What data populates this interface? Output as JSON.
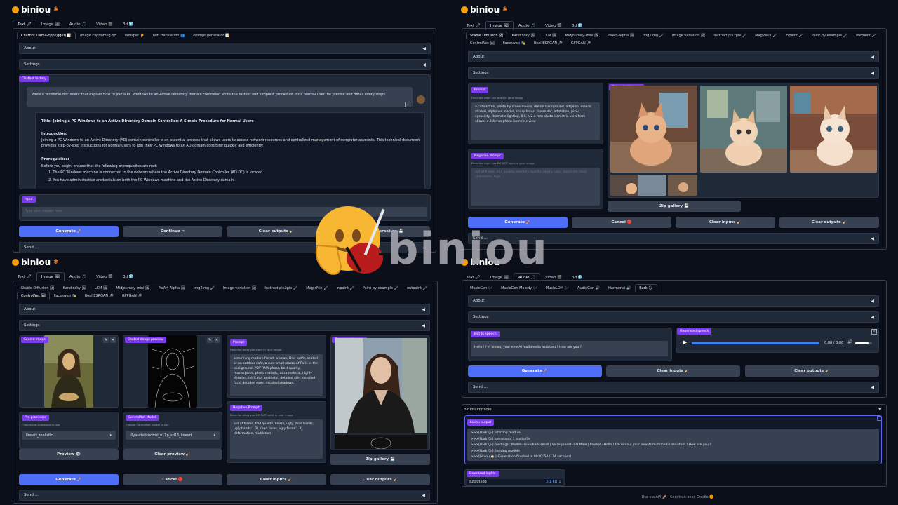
{
  "brand": {
    "name": "biniou",
    "big_name": "biniou"
  },
  "top_tabs": {
    "text": "Text 🖊",
    "image": "Image 🖼",
    "audio": "Audio 🎵",
    "video": "Video 🎬",
    "d3": "3d 🧊"
  },
  "q1": {
    "subtabs": [
      "Chatbot Llama-cpp (gguf) 📝",
      "Image captioning 👁",
      "Whisper 👂",
      "nllb translation 👥",
      "Prompt generator 📝"
    ],
    "about": "About",
    "settings": "Settings",
    "history_tag": "Chatbot history",
    "user_msg": "Write a technical document that explain how to join a PC Windows to an Active Directory domain controller. Write the fastest and simplest procedure for a normal user. Be precise and detail every steps.",
    "bot_title": "Title: Joining a PC Windows to an Active Directory Domain Controller: A Simple Procedure for Normal Users",
    "bot_intro_h": "Introduction:",
    "bot_intro": "Joining a PC Windows to an Active Directory (AD) domain controller is an essential process that allows users to access network resources and centralized management of computer accounts. This technical document provides step-by-step instructions for normal users to join their PC Windows to an AD domain controller quickly and efficiently.",
    "bot_pre_h": "Prerequisites:",
    "bot_pre": "Before you begin, ensure that the following prerequisites are met:",
    "bot_li1": "1. The PC Windows machine is connected to the network where the Active Directory Domain Controller (AD DC) is located.",
    "bot_li2": "2. You have administrative credentials on both the PC Windows machine and the Active Directory domain.",
    "input_tag": "Input",
    "input_ph": "Type your request here",
    "btn_generate": "Generate 🚀",
    "btn_continue": "Continue ➡",
    "btn_clear": "Clear outputs 🧹",
    "btn_save": "Save conversation 💾",
    "send": "Send ..."
  },
  "q2": {
    "subtabs_row1": [
      "Stable Diffusion 🖼",
      "Kandinsky 🖼",
      "LCM 🖼",
      "Midjourney-mini 🖼",
      "PixArt-Alpha 🖼",
      "img2img 🖌",
      "Image variation 🖼",
      "Instruct pix2pix 🖌",
      "MagicMix 🖌",
      "Inpaint 🖌",
      "Paint by example 🖌",
      "outpaint 🖌"
    ],
    "subtabs_row2": [
      "ControlNet 🖼",
      "Faceswap 🎭",
      "Real ESRGAN 🔎",
      "GFPGAN 🔎"
    ],
    "about": "About",
    "settings": "Settings",
    "prompt_tag": "Prompt",
    "prompt_hint": "Describe what you want in your image",
    "prompt": "a cute kitten,  photo by steve meisin, dream background, artgerm, malicic shinkai, alphonse macha, sharp focus, cinematic, artstation, pixiv, cgsociety, dramatic lighting, 8 k, a 2.4 mm photo isometric view from above. a 2.4 mm photo isometric view",
    "neg_tag": "Negative Prompt",
    "neg_hint": "Describe what you DO NOT want in your image",
    "neg": "out of frame, bad quality, medium quality, blurry, ugly, duplicate, text, characters, logo",
    "gen_tag": "Generated images",
    "zip": "Zip gallery 💾",
    "btn_generate": "Generate 🚀",
    "btn_cancel": "Cancel 🛑",
    "btn_clear_in": "Clear inputs 🧹",
    "btn_clear_out": "Clear outputs 🧹",
    "send": "Send ..."
  },
  "q3": {
    "subtabs_row1": [
      "Stable Diffusion 🖼",
      "Kandinsky 🖼",
      "LCM 🖼",
      "Midjourney-mini 🖼",
      "PixArt-Alpha 🖼",
      "img2img 🖌",
      "Image variation 🖼",
      "Instruct pix2pix 🖌",
      "MagicMix 🖌",
      "Inpaint 🖌",
      "Paint by example 🖌",
      "outpaint 🖌"
    ],
    "subtabs_row2": [
      "ControlNet 🖼",
      "Faceswap 🎭",
      "Real ESRGAN 🔎",
      "GFPGAN 🔎"
    ],
    "about": "About",
    "settings": "Settings",
    "source_tag": "Source image",
    "control_tag": "Control image preview",
    "prompt_tag": "Prompt",
    "prompt_hint": "Describe what you want in your image",
    "prompt": "a stunning modern french woman, Dior outfit, seated at an outdoor cafe, a cute small plazza of Paris in the background, POV RAW photo, best quality, masterpiece, photo realistic, ultra realistic, highly detailed, intricate, aesthetic, detailed skin, detailed face, detailed eyes, detailed shadows,",
    "neg_tag": "Negative Prompt",
    "neg_hint": "Describe what you DO NOT want in your image",
    "neg": "out of frame, bad quality, blurry, ugly, (bad hands, ugly hands:1.3), (bad faces, ugly faces:1.3), deformation, mutilation",
    "gen_tag": "Generated images",
    "pre_tag": "Pre-processor",
    "pre_hint": "Choose pre-processor to use",
    "pre_val": "lineart_realistic",
    "cn_tag": "ControlNet Model",
    "cn_hint": "Choose ControlNet model to use",
    "cn_val": "lllyasviel/control_v11p_sd15_lineart",
    "btn_preview": "Preview 👁",
    "btn_clear_preview": "Clear preview 🧹",
    "zip": "Zip gallery 💾",
    "btn_generate": "Generate 🚀",
    "btn_cancel": "Cancel 🛑",
    "btn_clear_in": "Clear inputs 🧹",
    "btn_clear_out": "Clear outputs 🧹",
    "send": "Send ..."
  },
  "q4": {
    "subtabs": [
      "MusicGen 🎶",
      "MusicGen Melody 🎶",
      "MusicLDM 🎶",
      "AudioGen 🔊",
      "Harmonai 🔊",
      "Bark 🗣"
    ],
    "about": "About",
    "settings": "Settings",
    "tts_tag": "Text to speech",
    "tts": "Hello ! I'm biniou, your new AI multimedia assistant ! How are you ?",
    "gen_tag": "Generated speech",
    "time": "0:08 / 0:08",
    "audio_progress": 1.0,
    "volume": 0.8,
    "btn_generate": "Generate 🚀",
    "btn_clear_in": "Clear inputs 🧹",
    "btn_clear_out": "Clear outputs 🧹",
    "send": "Send ...",
    "console_title": "biniou console",
    "output_tag": "biniou output",
    "log": [
      ">>>[Bark 🗣]: starting module",
      ">>>[Bark 🗣]: generated 1 audio file",
      ">>>[Bark 🗣]: Settings : Model=suno/bark-small | Voice preset=EN Male | Prompt=Hello ! I'm biniou, your new AI multimedia assistant ! How are you ?",
      ">>>[Bark 🗣]: leaving module",
      ">>>[biniou 🏠]: Generation finished in 00:02:54 (174 seconds)"
    ],
    "download_tag": "Download logfile",
    "file": "output.log",
    "filesize": "3.1 KB ↓",
    "footer": "Use via API 🚀  ·  Construit avec Gradio 🟠"
  },
  "colors": {
    "bg": "#0b0f19",
    "panel": "#1f2937",
    "primary": "#4f6ef7",
    "tag": "#7c3aed",
    "bar": "#3b82f6"
  }
}
